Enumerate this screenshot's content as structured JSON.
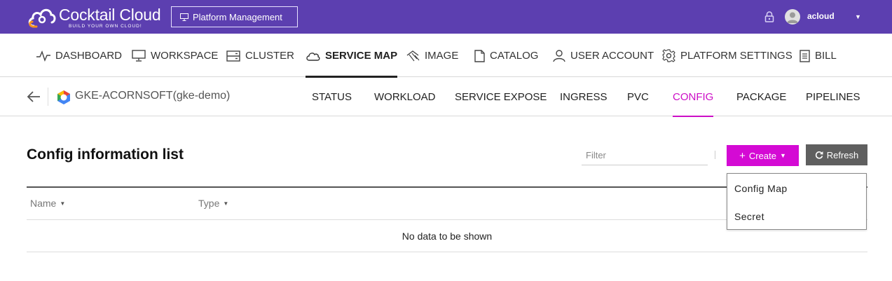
{
  "brand": {
    "title": "Cocktail Cloud",
    "tagline": "BUILD YOUR OWN CLOUD!",
    "color_primary": "#5c3fb0",
    "color_logo_orange": "#f7931e"
  },
  "header": {
    "platform_button": "Platform Management",
    "username": "acloud"
  },
  "main_nav": {
    "items": [
      {
        "label": "DASHBOARD",
        "icon": "pulse-icon"
      },
      {
        "label": "WORKSPACE",
        "icon": "monitor-icon"
      },
      {
        "label": "CLUSTER",
        "icon": "server-icon"
      },
      {
        "label": "SERVICE MAP",
        "icon": "cloud-icon",
        "active": true
      },
      {
        "label": "IMAGE",
        "icon": "image-icon"
      },
      {
        "label": "CATALOG",
        "icon": "document-icon"
      },
      {
        "label": "USER ACCOUNT",
        "icon": "user-icon"
      },
      {
        "label": "PLATFORM SETTINGS",
        "icon": "gear-icon"
      },
      {
        "label": "BILL",
        "icon": "bill-icon"
      }
    ]
  },
  "sub_nav": {
    "cluster_name": "GKE-ACORNSOFT(gke-demo)",
    "tabs": [
      {
        "label": "STATUS"
      },
      {
        "label": "WORKLOAD"
      },
      {
        "label": "SERVICE EXPOSE"
      },
      {
        "label": "INGRESS"
      },
      {
        "label": "PVC"
      },
      {
        "label": "CONFIG",
        "active": true
      },
      {
        "label": "PACKAGE"
      },
      {
        "label": "PIPELINES"
      }
    ],
    "active_color": "#cc0ec6"
  },
  "content": {
    "title": "Config information list",
    "filter_placeholder": "Filter",
    "create_label": "Create",
    "refresh_label": "Refresh",
    "create_color": "#d40ad4",
    "refresh_color": "#5f5f5f",
    "columns": [
      "Name",
      "Type"
    ],
    "empty_message": "No data to be shown"
  },
  "create_menu": {
    "items": [
      "Config Map",
      "Secret"
    ]
  }
}
